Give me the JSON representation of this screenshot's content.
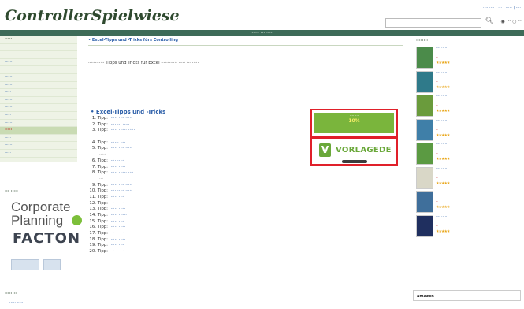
{
  "site": {
    "logo": "ControllerSpielwiese"
  },
  "header": {
    "top_links": "···· ···· | ··· | ····· | ····",
    "search_icon": "magnifier-icon",
    "radio_options": [
      "◉ ···",
      "○ ···"
    ]
  },
  "banner": {
    "text": "····· ··· ····"
  },
  "sidebar": {
    "items": [
      "······",
      "·····",
      "·····",
      "······",
      "·····",
      "······",
      "······",
      "·····",
      "······",
      "······",
      "·····",
      "······",
      "······",
      "·····",
      "······",
      "·····"
    ],
    "partner_heading": "··· ·····",
    "partners": [
      "Corporate Planning",
      "FACTON"
    ],
    "bottom_heading": "········",
    "bottom_link": "····· ······"
  },
  "main": {
    "breadcrumb": "• Excel-Tipps und -Tricks fürs Controlling",
    "intro": "············ Tipps und Tricks für Excel ············ ····· ··· ·····",
    "section_heading": "• Excel-Tipps und -Tricks",
    "tip_label": "Tipp:",
    "tips": [
      {
        "num": "1.",
        "text": "······ ···· ·····"
      },
      {
        "num": "2.",
        "text": "····· ··· ·····"
      },
      {
        "num": "3.",
        "text": "······ ······ ·····"
      },
      {
        "num": "",
        "text": "···",
        "sub": true
      },
      {
        "num": "4.",
        "text": "······· ····"
      },
      {
        "num": "5.",
        "text": "······ ···· ·····"
      },
      {
        "num": "",
        "text": "·····",
        "sub": true
      },
      {
        "num": "6.",
        "text": "····· ·····"
      },
      {
        "num": "7.",
        "text": "······ ·····"
      },
      {
        "num": "8.",
        "text": "······ ······ ····"
      },
      {
        "num": "",
        "text": "···",
        "sub": true
      },
      {
        "num": "9.",
        "text": "······ ···· ·····"
      },
      {
        "num": "10.",
        "text": "····· ····· ·····"
      },
      {
        "num": "11.",
        "text": "······ ····"
      },
      {
        "num": "12.",
        "text": "······ ····"
      },
      {
        "num": "13.",
        "text": "······ ·····"
      },
      {
        "num": "14.",
        "text": "······ ······"
      },
      {
        "num": "15.",
        "text": "······ ····"
      },
      {
        "num": "16.",
        "text": "······ ·····"
      },
      {
        "num": "17.",
        "text": "······ ····"
      },
      {
        "num": "18.",
        "text": "······ ·····"
      },
      {
        "num": "19.",
        "text": "······ ····"
      },
      {
        "num": "20.",
        "text": "······ ·····"
      }
    ]
  },
  "ads": {
    "ad1": {
      "line1": "········",
      "percent": "10%",
      "line2": "···· ···"
    },
    "ad2": {
      "icon_letter": "V",
      "label": "VORLAGEDE"
    }
  },
  "right": {
    "heading": "········",
    "books": [
      {
        "title": "···· ·····",
        "price": "··",
        "stars": "★★★★★",
        "color": "#4b8b4a"
      },
      {
        "title": "···· ·····",
        "price": "··",
        "stars": "★★★★★",
        "color": "#2f7a8a"
      },
      {
        "title": "···· ·····",
        "price": "··",
        "stars": "★★★★★",
        "color": "#6a9b3c"
      },
      {
        "title": "···· ·····",
        "price": "··",
        "stars": "★★★★★",
        "color": "#3f7fa8"
      },
      {
        "title": "···· ·····",
        "price": "··",
        "stars": "★★★★★",
        "color": "#5b9a42"
      },
      {
        "title": "···· ·····",
        "price": "··",
        "stars": "★★★★★",
        "color": "#d9d7c7"
      },
      {
        "title": "···· ·····",
        "price": "··",
        "stars": "★★★★★",
        "color": "#3f6f9b"
      },
      {
        "title": "···· ·····",
        "price": "··",
        "stars": "★★★★★",
        "color": "#1f2f5f"
      }
    ],
    "amazon_label": "amazon",
    "amazon_text": "······ ·····"
  }
}
